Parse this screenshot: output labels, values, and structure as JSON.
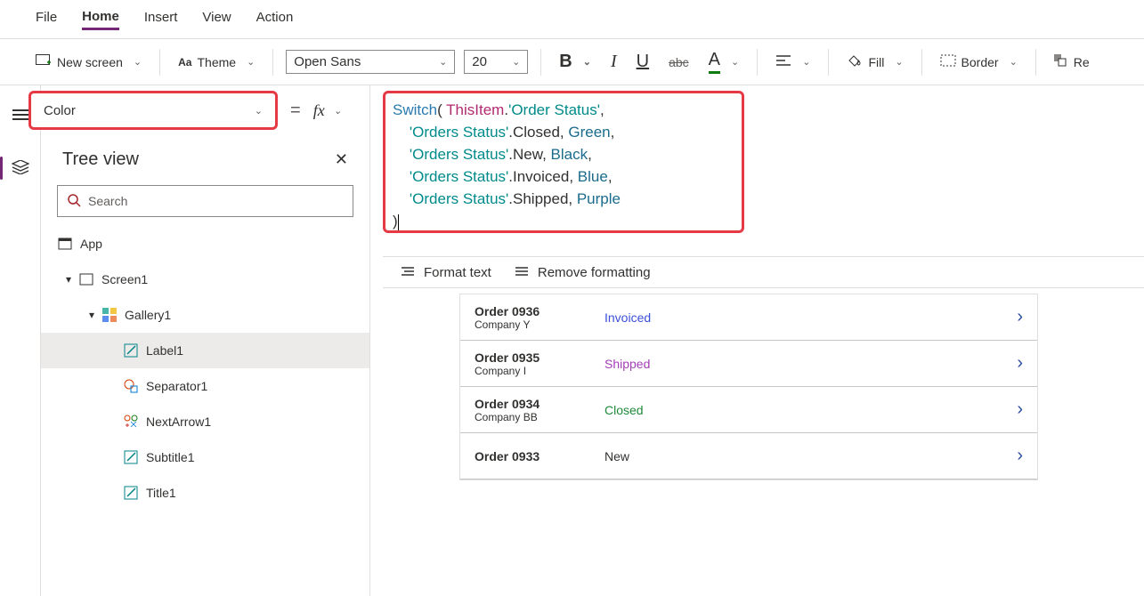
{
  "menu": {
    "items": [
      "File",
      "Home",
      "Insert",
      "View",
      "Action"
    ],
    "active": 1
  },
  "ribbon": {
    "new_screen": "New screen",
    "theme": "Theme",
    "font": "Open Sans",
    "font_size": "20",
    "fill": "Fill",
    "border": "Border",
    "re": "Re"
  },
  "property": {
    "name": "Color",
    "equals": "="
  },
  "formula_lines": [
    [
      {
        "t": "Switch",
        "c": "kw-switch"
      },
      {
        "t": "( "
      },
      {
        "t": "ThisItem",
        "c": "kw-this"
      },
      {
        "t": "."
      },
      {
        "t": "'Order Status'",
        "c": "kw-str"
      },
      {
        "t": ","
      }
    ],
    [
      {
        "t": "    "
      },
      {
        "t": "'Orders Status'",
        "c": "kw-str"
      },
      {
        "t": ".Closed, "
      },
      {
        "t": "Green",
        "c": "kw-green"
      },
      {
        "t": ","
      }
    ],
    [
      {
        "t": "    "
      },
      {
        "t": "'Orders Status'",
        "c": "kw-str"
      },
      {
        "t": ".New, "
      },
      {
        "t": "Black",
        "c": "kw-color"
      },
      {
        "t": ","
      }
    ],
    [
      {
        "t": "    "
      },
      {
        "t": "'Orders Status'",
        "c": "kw-str"
      },
      {
        "t": ".Invoiced, "
      },
      {
        "t": "Blue",
        "c": "kw-blue"
      },
      {
        "t": ","
      }
    ],
    [
      {
        "t": "    "
      },
      {
        "t": "'Orders Status'",
        "c": "kw-str"
      },
      {
        "t": ".Shipped, "
      },
      {
        "t": "Purple",
        "c": "kw-purple"
      }
    ],
    [
      {
        "t": ")"
      }
    ]
  ],
  "fbar": {
    "format": "Format text",
    "remove": "Remove formatting"
  },
  "tree": {
    "title": "Tree view",
    "search_ph": "Search",
    "nodes": [
      {
        "label": "App",
        "icon": "app",
        "level": 1
      },
      {
        "label": "Screen1",
        "icon": "screen",
        "level": 2,
        "expand": true
      },
      {
        "label": "Gallery1",
        "icon": "gallery",
        "level": 3,
        "expand": true
      },
      {
        "label": "Label1",
        "icon": "label",
        "level": 4,
        "selected": true
      },
      {
        "label": "Separator1",
        "icon": "sep",
        "level": 4
      },
      {
        "label": "NextArrow1",
        "icon": "next",
        "level": 4
      },
      {
        "label": "Subtitle1",
        "icon": "label",
        "level": 4
      },
      {
        "label": "Title1",
        "icon": "label",
        "level": 4
      }
    ]
  },
  "orders": [
    {
      "title": "Order 0936",
      "sub": "Company Y",
      "status": "Invoiced",
      "cls": "c-invoiced"
    },
    {
      "title": "Order 0935",
      "sub": "Company I",
      "status": "Shipped",
      "cls": "c-shipped"
    },
    {
      "title": "Order 0934",
      "sub": "Company BB",
      "status": "Closed",
      "cls": "c-closed"
    },
    {
      "title": "Order 0933",
      "sub": "",
      "status": "New",
      "cls": "c-new"
    }
  ]
}
